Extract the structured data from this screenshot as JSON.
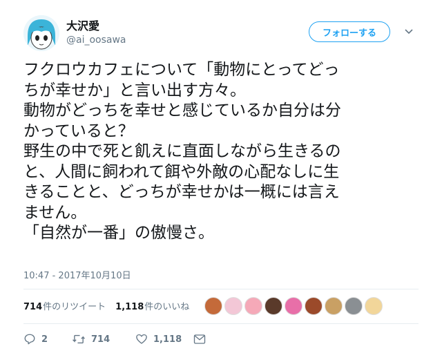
{
  "user": {
    "name": "大沢愛",
    "handle": "@ai_oosawa",
    "follow_label": "フォローする"
  },
  "tweet": {
    "lines": [
      "フクロウカフェについて「動物にとってどっ",
      "ちが幸せか」と言い出す方々。",
      "動物がどっちを幸せと感じているか自分は分",
      "かっていると？",
      "野生の中で死と飢えに直面しながら生きるの",
      "と、人間に飼われて餌や外敵の心配なしに生",
      "きることと、どっちが幸せかは一概には言え",
      "ません。",
      "「自然が一番」の傲慢さ。"
    ],
    "timestamp": "10:47 - 2017年10月10日"
  },
  "stats": {
    "retweets_count": "714",
    "retweets_label": "件のリツイート",
    "likes_count": "1,118",
    "likes_label": "件のいいね"
  },
  "likers": [
    {
      "color": "#c46a3a"
    },
    {
      "color": "#f3c7d6"
    },
    {
      "color": "#f5a9b8"
    },
    {
      "color": "#5a3a2a"
    },
    {
      "color": "#e86fa8"
    },
    {
      "color": "#9b4a2a"
    },
    {
      "color": "#c9a064"
    },
    {
      "color": "#8a8f93"
    },
    {
      "color": "#f2d69a"
    }
  ],
  "actions": {
    "reply_count": "2",
    "retweet_count": "714",
    "like_count": "1,118"
  },
  "colors": {
    "accent": "#1da1f2",
    "text": "#14171a",
    "muted": "#657786"
  }
}
